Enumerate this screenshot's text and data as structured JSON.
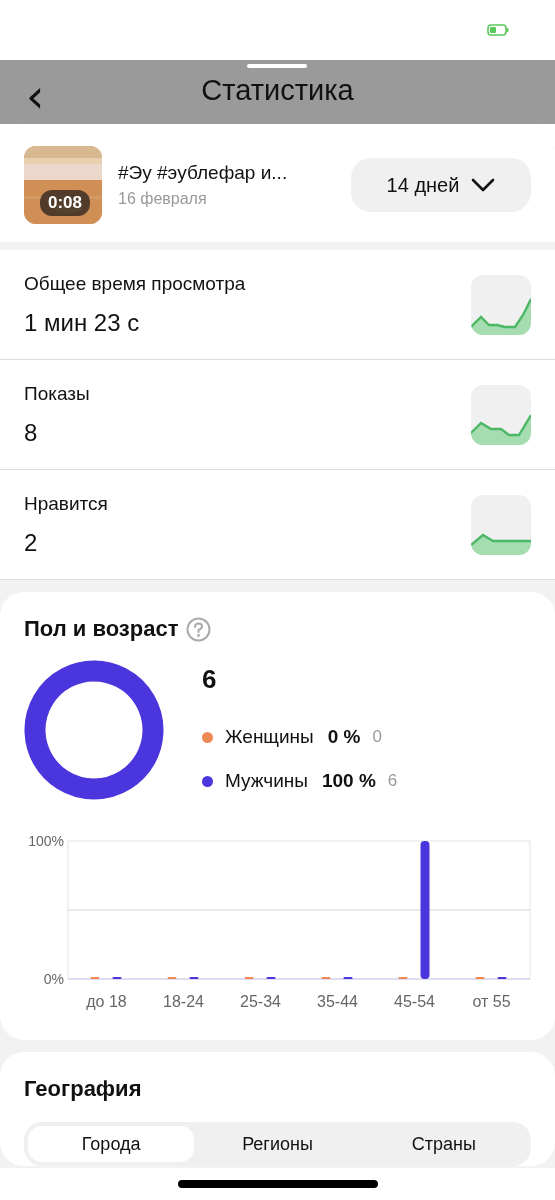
{
  "nav": {
    "back": "‹",
    "title": "Статистика"
  },
  "video": {
    "kind": "picture",
    "duration": "0:08",
    "title": "#Эу #эублефар и...",
    "date": "16 февраля"
  },
  "period": {
    "label": "14 дней"
  },
  "metrics": [
    {
      "label": "Общее время просмотра",
      "value": "1 мин 23 с"
    },
    {
      "label": "Показы",
      "value": "8"
    },
    {
      "label": "Нравится",
      "value": "2"
    }
  ],
  "gender_age": {
    "title": "Пол и возраст",
    "total": "6",
    "donut": {
      "kind": "donut"
    },
    "legend": [
      {
        "label": "Женщины",
        "percent": "0 %",
        "count": "0",
        "color": "#f08a55"
      },
      {
        "label": "Мужчины",
        "percent": "100 %",
        "count": "6",
        "color": "#4b35dc"
      }
    ],
    "age_chart": {
      "chart_data": {
        "type": "bar",
        "categories": [
          "до 18",
          "18-24",
          "25-34",
          "35-44",
          "45-54",
          "от 55"
        ],
        "series": [
          {
            "color": "#f08a55",
            "values": [
              0,
              0,
              0,
              0,
              0,
              0
            ]
          },
          {
            "color": "#4b35dc",
            "values": [
              0,
              0,
              0,
              0,
              100,
              0
            ]
          }
        ],
        "ylim": [
          0,
          100
        ],
        "yticks": [
          {
            "value": 0,
            "label": "0%"
          },
          {
            "value": 100,
            "label": "100%"
          }
        ]
      }
    }
  },
  "geography": {
    "title": "География",
    "tabs": [
      {
        "label": "Города",
        "selected": true
      },
      {
        "label": "Регионы",
        "selected": false
      },
      {
        "label": "Страны",
        "selected": false
      }
    ]
  }
}
